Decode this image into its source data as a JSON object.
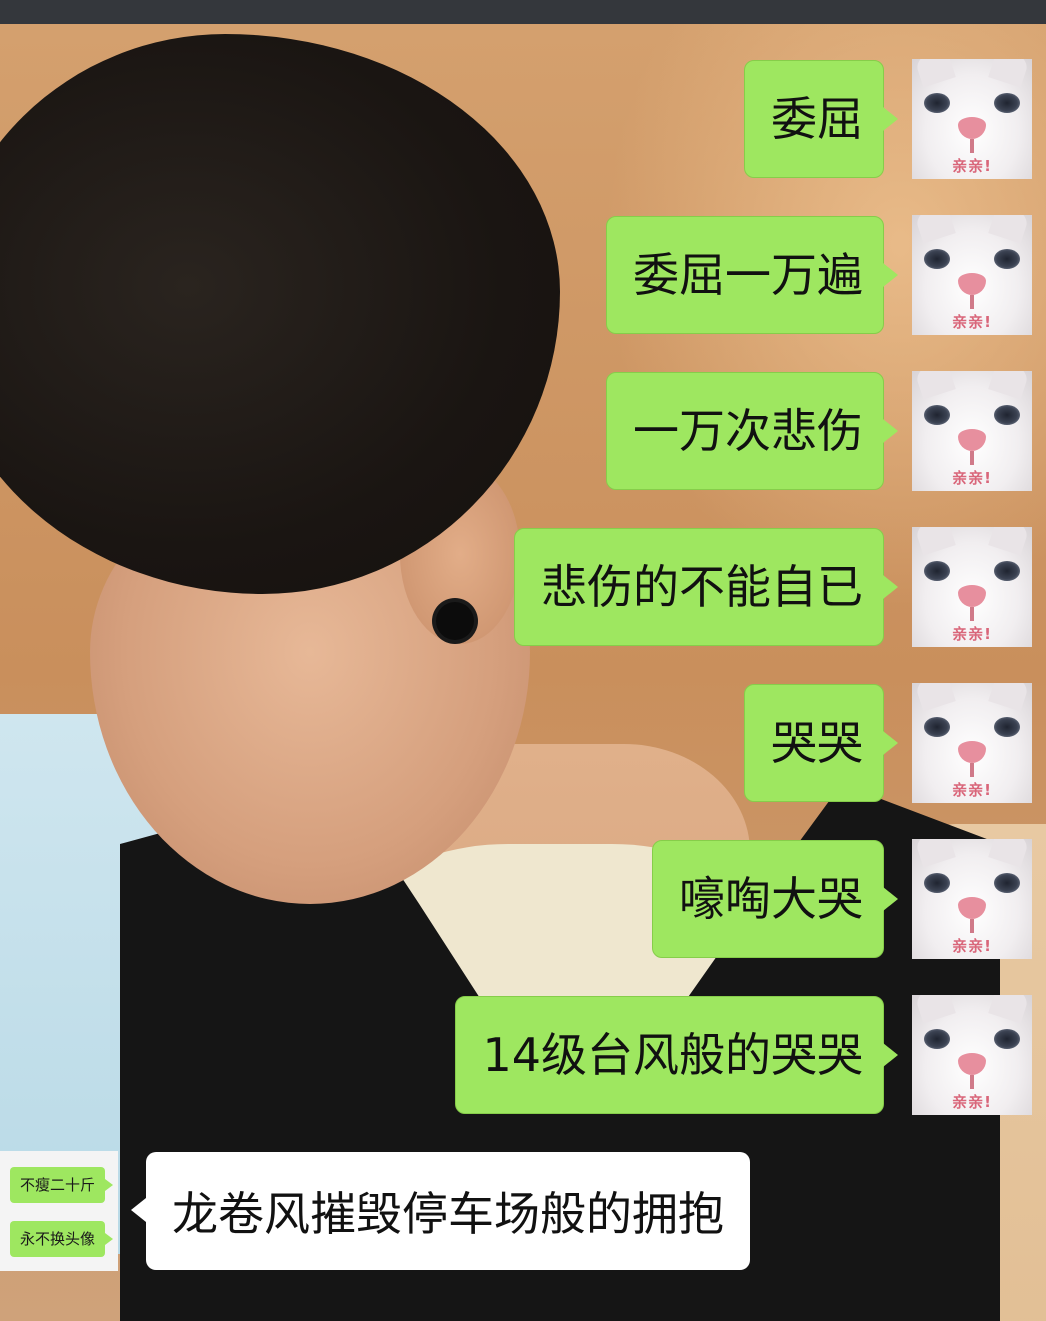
{
  "chat": {
    "outgoing": [
      {
        "text": "委屈"
      },
      {
        "text": "委屈一万遍"
      },
      {
        "text": "一万次悲伤"
      },
      {
        "text": "悲伤的不能自已"
      },
      {
        "text": "哭哭"
      },
      {
        "text": "嚎啕大哭"
      },
      {
        "text": "14级台风般的哭哭"
      }
    ],
    "self_avatar": {
      "caption": "亲亲!",
      "icon": "white-cat-avatar"
    },
    "incoming": {
      "text": "龙卷风摧毁停车场般的拥抱",
      "avatar": {
        "line1": "不瘦二十斤",
        "line2": "永不换头像"
      }
    }
  },
  "colors": {
    "outgoing_bubble": "#9ee760",
    "incoming_bubble": "#ffffff",
    "status_bar": "#34373c"
  }
}
